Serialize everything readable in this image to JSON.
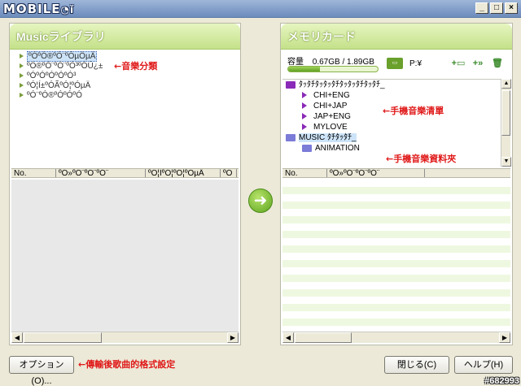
{
  "window": {
    "logo": "MOBILE",
    "minimize": "_",
    "maximize": "□",
    "close": "×"
  },
  "left_panel": {
    "title": "Musicライブラリ",
    "tree": [
      {
        "label": "ºÓºÓ®ºÓ¨ºÓµÖµÄ",
        "selected": true
      },
      {
        "label": "ºÓ®ºÓ¨ºÓ¨ºÓ³ºÓÚ¿±",
        "selected": false
      },
      {
        "label": "ºÓºÓºÓºÓºÓ³",
        "selected": false
      },
      {
        "label": "ºÓ¦Í±ºÓÃºÓ¦ºÓµÄ",
        "selected": false
      },
      {
        "label": "ºÓ¨ºÓ®ºÓºÓºÓ",
        "selected": false
      }
    ],
    "columns": [
      "No.",
      "ºÓ»ºÓ¨ºÓ¨ºÓ¨",
      "ºÓ¦ÍºÓ¦ºÓ¦ºÓµÄ",
      "ºÓ"
    ]
  },
  "right_panel": {
    "title": "メモリカード",
    "capacity_label": "容量",
    "capacity_used": "0.67GB / 1.89GB",
    "capacity_fraction": 0.354,
    "drive_label": "P:¥",
    "device_root": "ﾀｯﾀﾁﾀｯﾀｯﾀﾁﾀｯﾀｯﾀﾁﾀｯﾀﾁ_",
    "playlists": [
      "CHI+ENG",
      "CHI+JAP",
      "JAP+ENG",
      "MYLOVE"
    ],
    "music_folder": "MUSIC ﾀﾁﾀｯﾀﾁ_",
    "subfolders": [
      "ANIMATION"
    ],
    "columns": [
      "No.",
      "ºÓ»ºÓ¨ºÓ¨ºÓ¨"
    ]
  },
  "buttons": {
    "options": "オプション(O)...",
    "close": "閉じる(C)",
    "help": "ヘルプ(H)"
  },
  "annotations": {
    "music_category": "←音樂分類",
    "phone_music_list": "←手機音樂清單",
    "phone_music_folder": "←手機音樂資料夾",
    "format_setting": "←傳輸後歌曲的格式設定"
  },
  "watermark": "#682993"
}
